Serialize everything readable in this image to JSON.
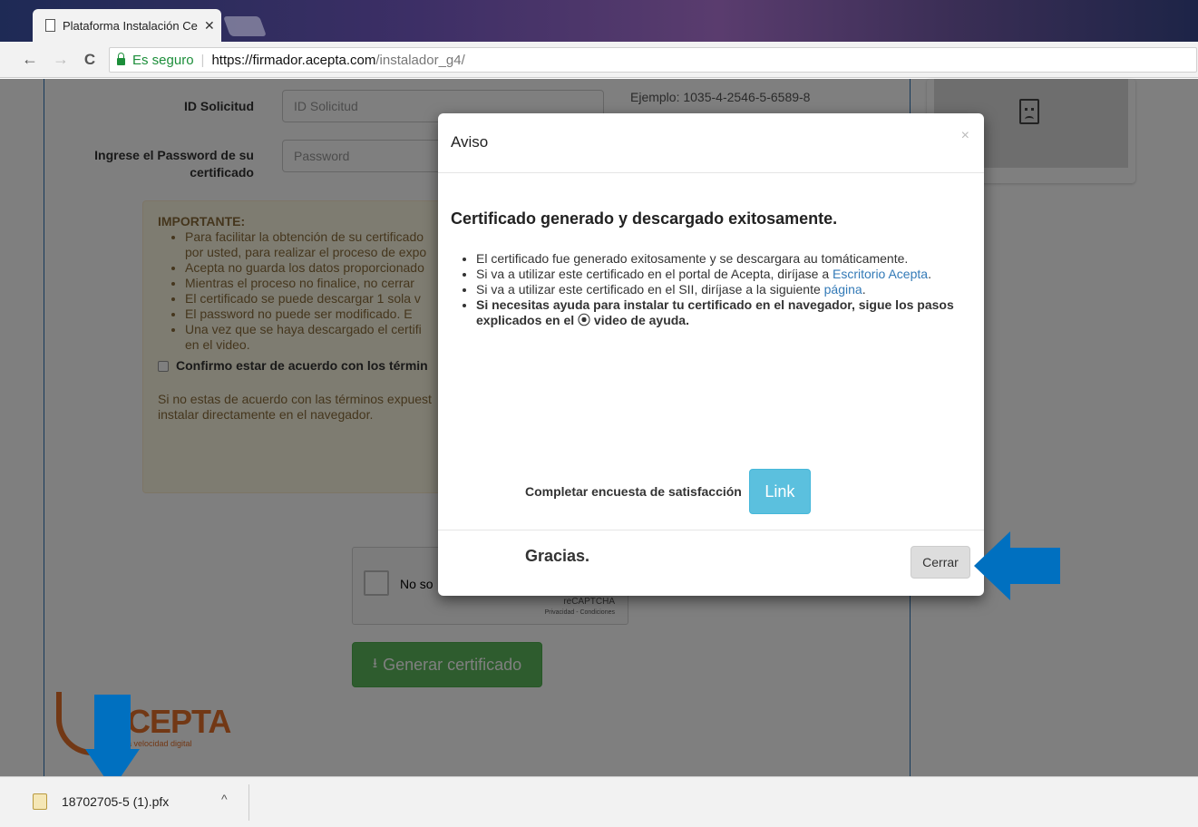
{
  "browser": {
    "tab_title": "Plataforma Instalación Ce",
    "tab_close": "✕",
    "back": "←",
    "forward": "→",
    "reload": "C",
    "secure_label": "Es seguro",
    "url_scheme_host": "https://firmador.acepta.com",
    "url_path": "/instalador_g4/"
  },
  "form": {
    "id_label": "ID Solicitud",
    "id_placeholder": "ID Solicitud",
    "id_example": "Ejemplo: 1035-4-2546-5-6589-8",
    "password_label_line1": "Ingrese el Password de su",
    "password_label_line2": "certificado",
    "password_placeholder": "Password"
  },
  "important": {
    "title": "IMPORTANTE:",
    "items": [
      "Para facilitar la obtención de su certificado",
      "por usted, para realizar el proceso de expo",
      "Acepta no guarda los datos proporcionado",
      "Mientras el proceso no finalice, no cerrar",
      "El certificado se puede descargar 1 sola v",
      "El password no puede ser modificado. E",
      "Una vez que se haya descargado el certifi",
      "en el video."
    ],
    "confirm_label": "Confirmo estar de acuerdo con los términ",
    "footer_line1": "Si no estas de acuerdo con las términos expuest",
    "footer_line2": "instalar directamente en el navegador."
  },
  "captcha": {
    "label": "No so",
    "brand": "reCAPTCHA",
    "links": "Privacidad - Condiciones"
  },
  "generate_button": "Generar certificado",
  "logo": {
    "text": "CEPTA",
    "tagline": "a velocidad digital"
  },
  "modal": {
    "title": "Aviso",
    "close_x": "×",
    "heading": "Certificado generado y descargado exitosamente.",
    "item1": "El certificado fue generado exitosamente y se descargara au tomáticamente.",
    "item2_prefix": "Si va a utilizar este certificado en el portal de Acepta, diríjase a ",
    "item2_link": "Escritorio Acepta",
    "item2_suffix": ".",
    "item3_prefix": "Si va a utilizar este certificado en el SII, diríjase a la siguiente ",
    "item3_link": "página",
    "item3_suffix": ".",
    "item4": "Si necesitas ayuda para instalar tu certificado en el navegador, sigue los pasos explicados en el ⦿ video de ayuda.",
    "survey_label": "Completar encuesta de satisfacción",
    "survey_button": "Link",
    "thanks": "Gracias.",
    "close_button": "Cerrar"
  },
  "download_bar": {
    "filename": "18702705-5 (1).pfx",
    "chevron": "^"
  },
  "colors": {
    "arrow": "#0070c0",
    "primary_green": "#5cb85c",
    "info_blue": "#5bc0de",
    "brand_orange": "#e4702a"
  }
}
